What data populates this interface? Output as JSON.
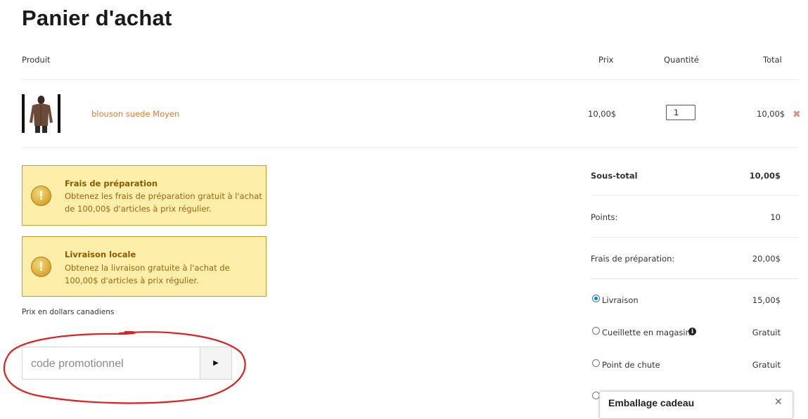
{
  "page": {
    "title": "Panier d'achat"
  },
  "table": {
    "headers": {
      "product": "Produit",
      "price": "Prix",
      "quantity": "Quantité",
      "total": "Total"
    },
    "items": [
      {
        "name": "blouson suede Moyen",
        "price": "10,00$",
        "quantity": "1",
        "total": "10,00$",
        "image_icon": "brown-jacket-photo",
        "remove_icon": "close-icon"
      }
    ]
  },
  "notices": [
    {
      "title": "Frais de préparation",
      "text": "Obtenez les frais de préparation gratuit à l'achat de 100,00$ d'articles à prix régulier.",
      "icon": "warning-exclamation-icon"
    },
    {
      "title": "Livraison locale",
      "text": "Obtenez la livraison gratuite à l'achat de 100,00$ d'articles à prix régulier.",
      "icon": "warning-exclamation-icon"
    }
  ],
  "currency_note": "Prix en dollars canadiens",
  "promo": {
    "placeholder": "code promotionnel",
    "button_icon": "caret-right-icon"
  },
  "summary": {
    "subtotal_label": "Sous-total",
    "subtotal_value": "10,00$",
    "points_label": "Points:",
    "points_value": "10",
    "prep_label": "Frais de préparation:",
    "prep_value": "20,00$"
  },
  "shipping_options": [
    {
      "label": "Livraison",
      "value": "15,00$",
      "selected": true
    },
    {
      "label": "Cueillette en magasin",
      "value": "Gratuit",
      "selected": false,
      "info_icon": "info-icon"
    },
    {
      "label": "Point de chute",
      "value": "Gratuit",
      "selected": false
    }
  ],
  "gift_popup": {
    "title": "Emballage cadeau",
    "close_icon": "close-icon"
  },
  "colors": {
    "link": "#e8782b",
    "notice_bg": "#fdefa9",
    "notice_border": "#c59b2c",
    "notice_title": "#8a5a00",
    "notice_text": "#9a6410",
    "annotation_circle": "#e0201c",
    "radio_selected": "#2472d6"
  }
}
